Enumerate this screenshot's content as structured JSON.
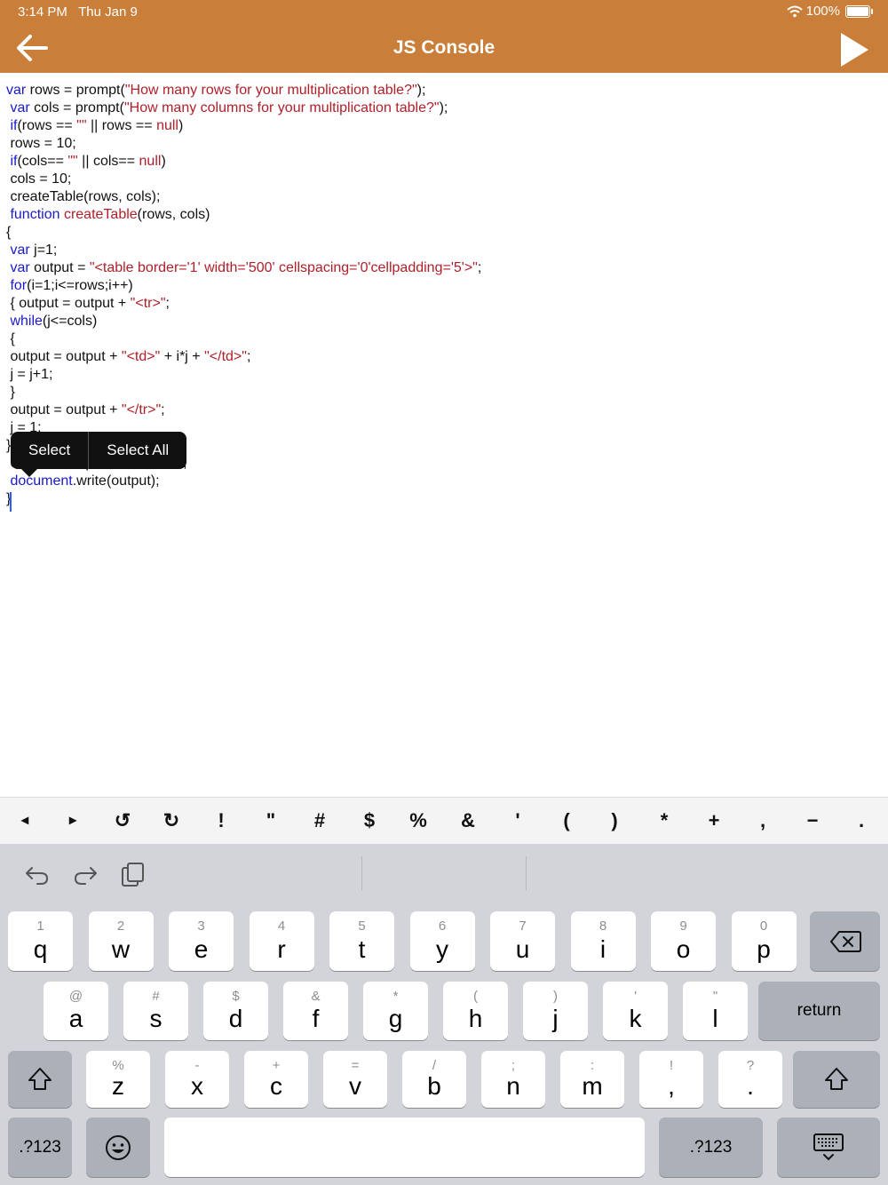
{
  "status": {
    "time": "3:14 PM",
    "date": "Thu Jan 9",
    "battery": "100%"
  },
  "header": {
    "title": "JS Console"
  },
  "context_menu": {
    "select": "Select",
    "select_all": "Select All"
  },
  "accessory": {
    "keys": [
      "◂",
      "▸",
      "↺",
      "↻",
      "!",
      "\"",
      "#",
      "$",
      "%",
      "&",
      "'",
      "(",
      ")",
      "*",
      "+",
      ",",
      "−",
      "."
    ]
  },
  "keyboard": {
    "row1": [
      {
        "hint": "1",
        "main": "q"
      },
      {
        "hint": "2",
        "main": "w"
      },
      {
        "hint": "3",
        "main": "e"
      },
      {
        "hint": "4",
        "main": "r"
      },
      {
        "hint": "5",
        "main": "t"
      },
      {
        "hint": "6",
        "main": "y"
      },
      {
        "hint": "7",
        "main": "u"
      },
      {
        "hint": "8",
        "main": "i"
      },
      {
        "hint": "9",
        "main": "o"
      },
      {
        "hint": "0",
        "main": "p"
      }
    ],
    "row2": [
      {
        "hint": "@",
        "main": "a"
      },
      {
        "hint": "#",
        "main": "s"
      },
      {
        "hint": "$",
        "main": "d"
      },
      {
        "hint": "&",
        "main": "f"
      },
      {
        "hint": "*",
        "main": "g"
      },
      {
        "hint": "(",
        "main": "h"
      },
      {
        "hint": ")",
        "main": "j"
      },
      {
        "hint": "'",
        "main": "k"
      },
      {
        "hint": "\"",
        "main": "l"
      }
    ],
    "row3": [
      {
        "hint": "%",
        "main": "z"
      },
      {
        "hint": "-",
        "main": "x"
      },
      {
        "hint": "+",
        "main": "c"
      },
      {
        "hint": "=",
        "main": "v"
      },
      {
        "hint": "/",
        "main": "b"
      },
      {
        "hint": ";",
        "main": "n"
      },
      {
        "hint": ":",
        "main": "m"
      },
      {
        "hint": "!",
        "main": ","
      },
      {
        "hint": "?",
        "main": "."
      }
    ],
    "return": "return",
    "numbers": ".?123"
  }
}
